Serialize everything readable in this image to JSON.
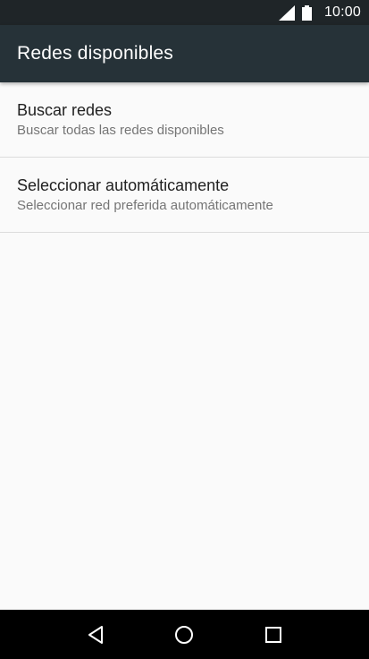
{
  "status_bar": {
    "time": "10:00",
    "icons": [
      "signal-icon",
      "battery-icon"
    ]
  },
  "app_bar": {
    "title": "Redes disponibles"
  },
  "list": {
    "items": [
      {
        "title": "Buscar redes",
        "subtitle": "Buscar todas las redes disponibles"
      },
      {
        "title": "Seleccionar automáticamente",
        "subtitle": "Seleccionar red preferida automáticamente"
      }
    ]
  },
  "nav_bar": {
    "icons": [
      "back-icon",
      "home-icon",
      "recents-icon"
    ]
  },
  "colors": {
    "status_bar_bg": "#1f2528",
    "app_bar_bg": "#263238",
    "background": "#fafafa",
    "nav_bar_bg": "#000000"
  }
}
